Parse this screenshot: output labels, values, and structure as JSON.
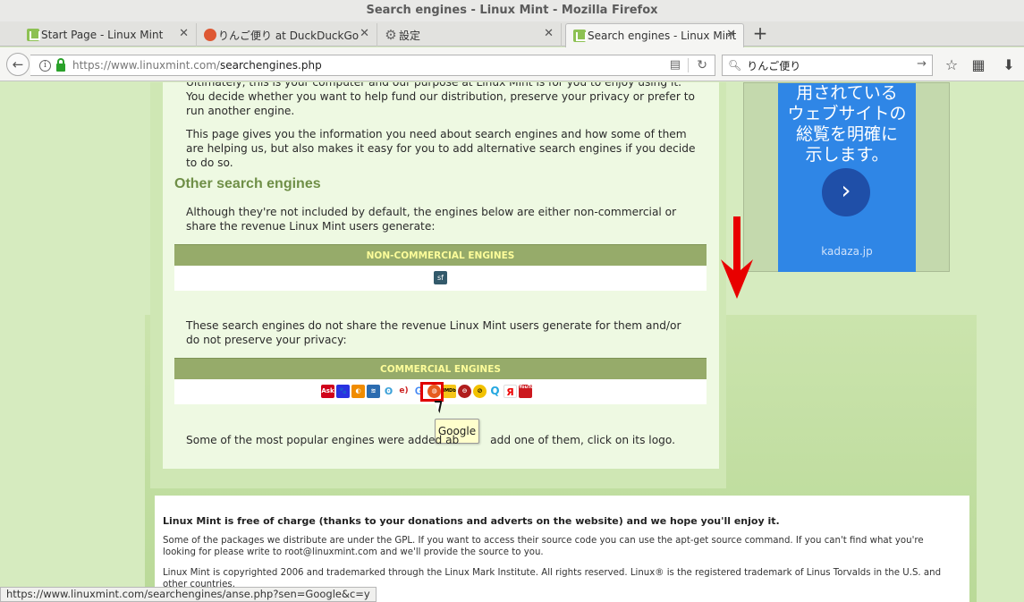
{
  "window": {
    "title": "Search engines - Linux Mint - Mozilla Firefox"
  },
  "tabs": [
    {
      "label": "Start Page - Linux Mint",
      "icon": "linux-mint-icon"
    },
    {
      "label": "りんご便り at DuckDuckGo",
      "icon": "duckduckgo-icon"
    },
    {
      "label": "設定",
      "icon": "gear-icon"
    },
    {
      "label": "Search engines - Linux Mint",
      "icon": "linux-mint-icon",
      "active": true
    }
  ],
  "navbar": {
    "url_prefix": "https://www.linuxmint.com/",
    "url_path": "searchengines.php",
    "search_value": "りんご便り"
  },
  "page": {
    "intro_top": "Ultimately, this is your computer and our purpose at Linux Mint is for you to enjoy using it. You decide whether you want to help fund our distribution, preserve your privacy or prefer to run another engine.",
    "intro_2": "This page gives you the information you need about search engines and how some of them are helping us, but also makes it easy for you to add alternative search engines if you decide to do so.",
    "heading": "Other search engines",
    "other_intro": "Although they're not included by default, the engines below are either non-commercial or share the revenue Linux Mint users generate:",
    "noncommercial_header": "NON-COMMERCIAL ENGINES",
    "noncommercial_icon": "sf",
    "commercial_intro": "These search engines do not share the revenue Linux Mint users generate for them and/or do not preserve your privacy:",
    "commercial_header": "COMMERCIAL ENGINES",
    "engines": [
      "Ask",
      "Baidu",
      "Bing",
      "",
      "",
      "",
      "G",
      "",
      "IMDb",
      "",
      "",
      "",
      "Я",
      "YouTube"
    ],
    "tooltip": "Google",
    "outro": "Some of the most popular engines were added ab         add one of them, click on its logo."
  },
  "ad": {
    "text": "用されている\nウェブサイトの\n総覧を明確に\n示します。",
    "button_icon": "chevron-right-icon",
    "domain": "kadaza.jp"
  },
  "footer": {
    "bold": "Linux Mint is free of charge (thanks to your donations and adverts on the website) and we hope you'll enjoy it.",
    "p1": "Some of the packages we distribute are under the GPL. If you want to access their source code you can use the apt-get source command. If you can't find what you're looking for please write to root@linuxmint.com and we'll provide the source to you.",
    "p2": "Linux Mint is copyrighted 2006 and trademarked through the Linux Mark Institute. All rights reserved. Linux® is the registered trademark of Linus Torvalds in the U.S. and other countries."
  },
  "status": {
    "url": "https://www.linuxmint.com/searchengines/anse.php?sen=Google&c=y"
  },
  "colors": {
    "accent_arrow": "#e80000",
    "heading_green": "#6f8f47",
    "table_header": "#96ab6a",
    "table_header_text": "#fdfd9a"
  }
}
